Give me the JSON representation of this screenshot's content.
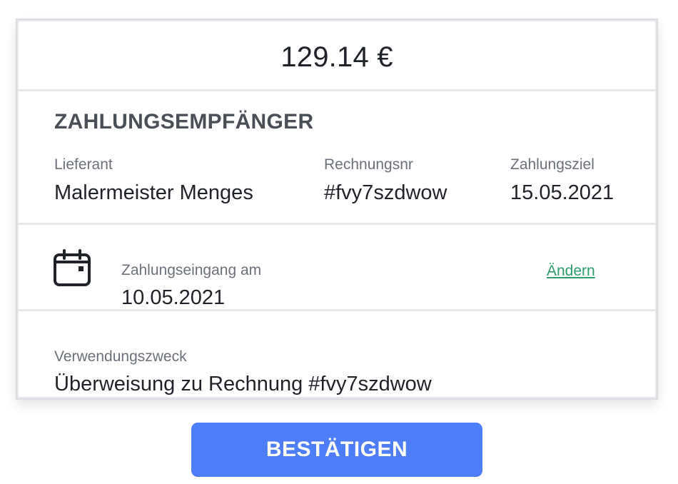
{
  "amount": "129.14 €",
  "payee": {
    "title": "ZAHLUNGSEMPFÄNGER",
    "supplier_label": "Lieferant",
    "supplier_value": "Malermeister Menges",
    "invoice_label": "Rechnungsnr",
    "invoice_value": "#fvy7szdwow",
    "due_label": "Zahlungsziel",
    "due_value": "15.05.2021"
  },
  "payment_date": {
    "icon": "calendar-icon",
    "label": "Zahlungseingang am",
    "value": "10.05.2021",
    "change_label": "Ändern"
  },
  "purpose": {
    "label": "Verwendungszweck",
    "value": "Überweisung zu Rechnung #fvy7szdwow"
  },
  "confirm_label": "BESTÄTIGEN",
  "colors": {
    "primary_button": "#4e7ef7",
    "link": "#2f9b6a",
    "text": "#1f2329",
    "muted": "#6b7079"
  }
}
